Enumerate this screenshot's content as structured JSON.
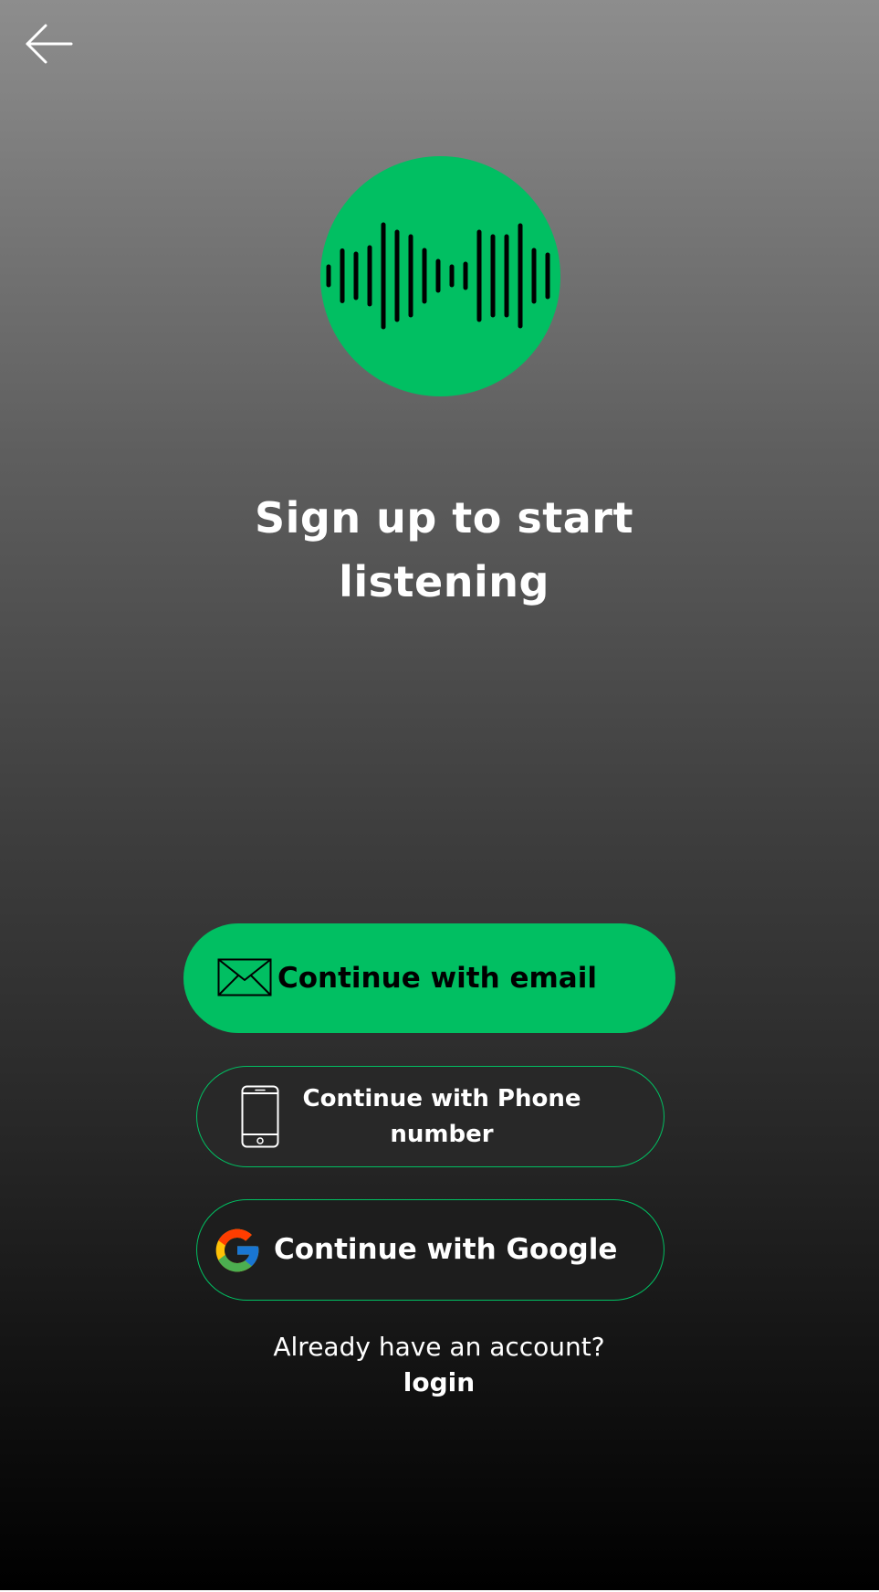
{
  "colors": {
    "accent": "#01bf62",
    "text": "#ffffff",
    "button_text_dark": "#000000"
  },
  "nav": {
    "back_icon": "arrow-left-icon"
  },
  "logo": {
    "icon": "sound-wave-icon"
  },
  "heading": {
    "line1": "Sign up to start",
    "line2": "listening"
  },
  "buttons": {
    "email": {
      "label": "Continue with email",
      "icon": "envelope-icon"
    },
    "phone": {
      "label_line1": "Continue with Phone",
      "label_line2": "number",
      "icon": "smartphone-icon"
    },
    "google": {
      "label": "Continue with Google",
      "icon": "google-logo-icon"
    }
  },
  "footer": {
    "prompt": "Already have an account?",
    "login_label": "login"
  }
}
